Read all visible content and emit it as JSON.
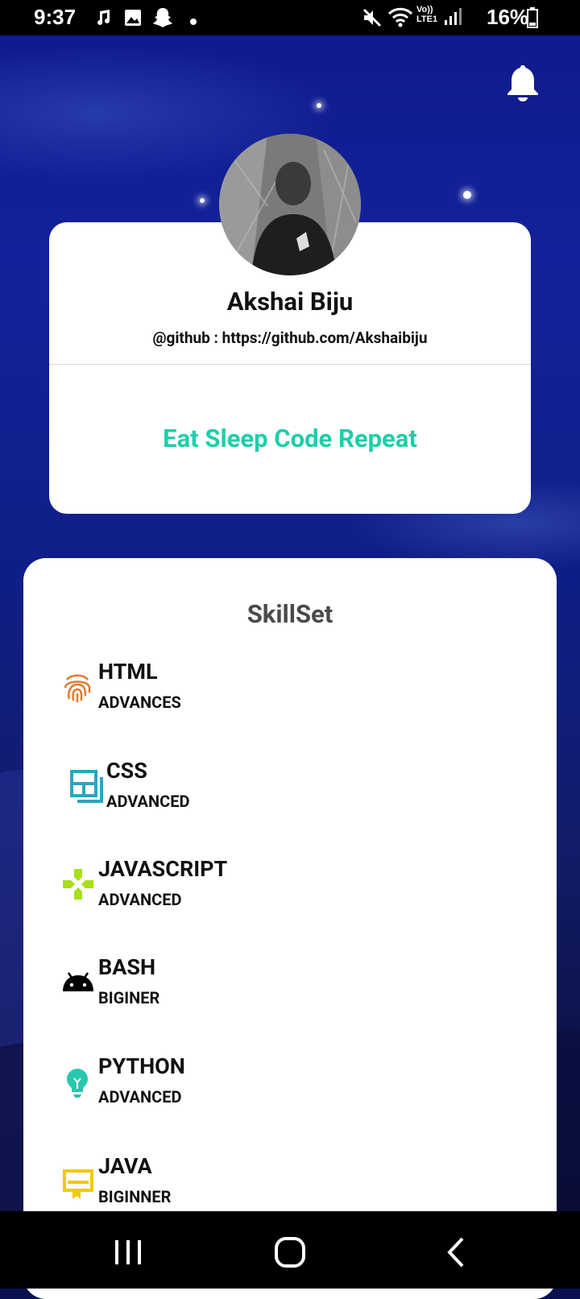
{
  "status_bar": {
    "time": "9:37",
    "battery": "16%",
    "network": "LTE1",
    "icons": [
      "music-note-icon",
      "image-icon",
      "snapchat-icon",
      "dot-icon",
      "mute-icon",
      "wifi-icon",
      "signal-icon",
      "battery-icon"
    ]
  },
  "header": {
    "notification_icon": "bell-icon"
  },
  "profile": {
    "name": "Akshai Biju",
    "github": "@github : https://github.com/Akshaibiju",
    "tagline": "Eat Sleep Code Repeat",
    "tagline_color": "#1ccfa9"
  },
  "skillset": {
    "title": "SkillSet",
    "items": [
      {
        "name": "HTML",
        "level": "ADVANCES",
        "icon": "fingerprint-icon",
        "color": "#e07b30"
      },
      {
        "name": "CSS",
        "level": "ADVANCED",
        "icon": "dashboard-icon",
        "color": "#2aa6bf"
      },
      {
        "name": "JAVASCRIPT",
        "level": "ADVANCED",
        "icon": "gamepad-icon",
        "color": "#a8e019"
      },
      {
        "name": "BASH",
        "level": "BIGINER",
        "icon": "android-icon",
        "color": "#000000"
      },
      {
        "name": "PYTHON",
        "level": "ADVANCED",
        "icon": "lightbulb-icon",
        "color": "#29c6ad"
      },
      {
        "name": "JAVA",
        "level": "BIGINNER",
        "icon": "certificate-icon",
        "color": "#f2c80f"
      }
    ]
  },
  "nav": {
    "buttons": [
      "recents-icon",
      "home-icon",
      "back-icon"
    ]
  }
}
